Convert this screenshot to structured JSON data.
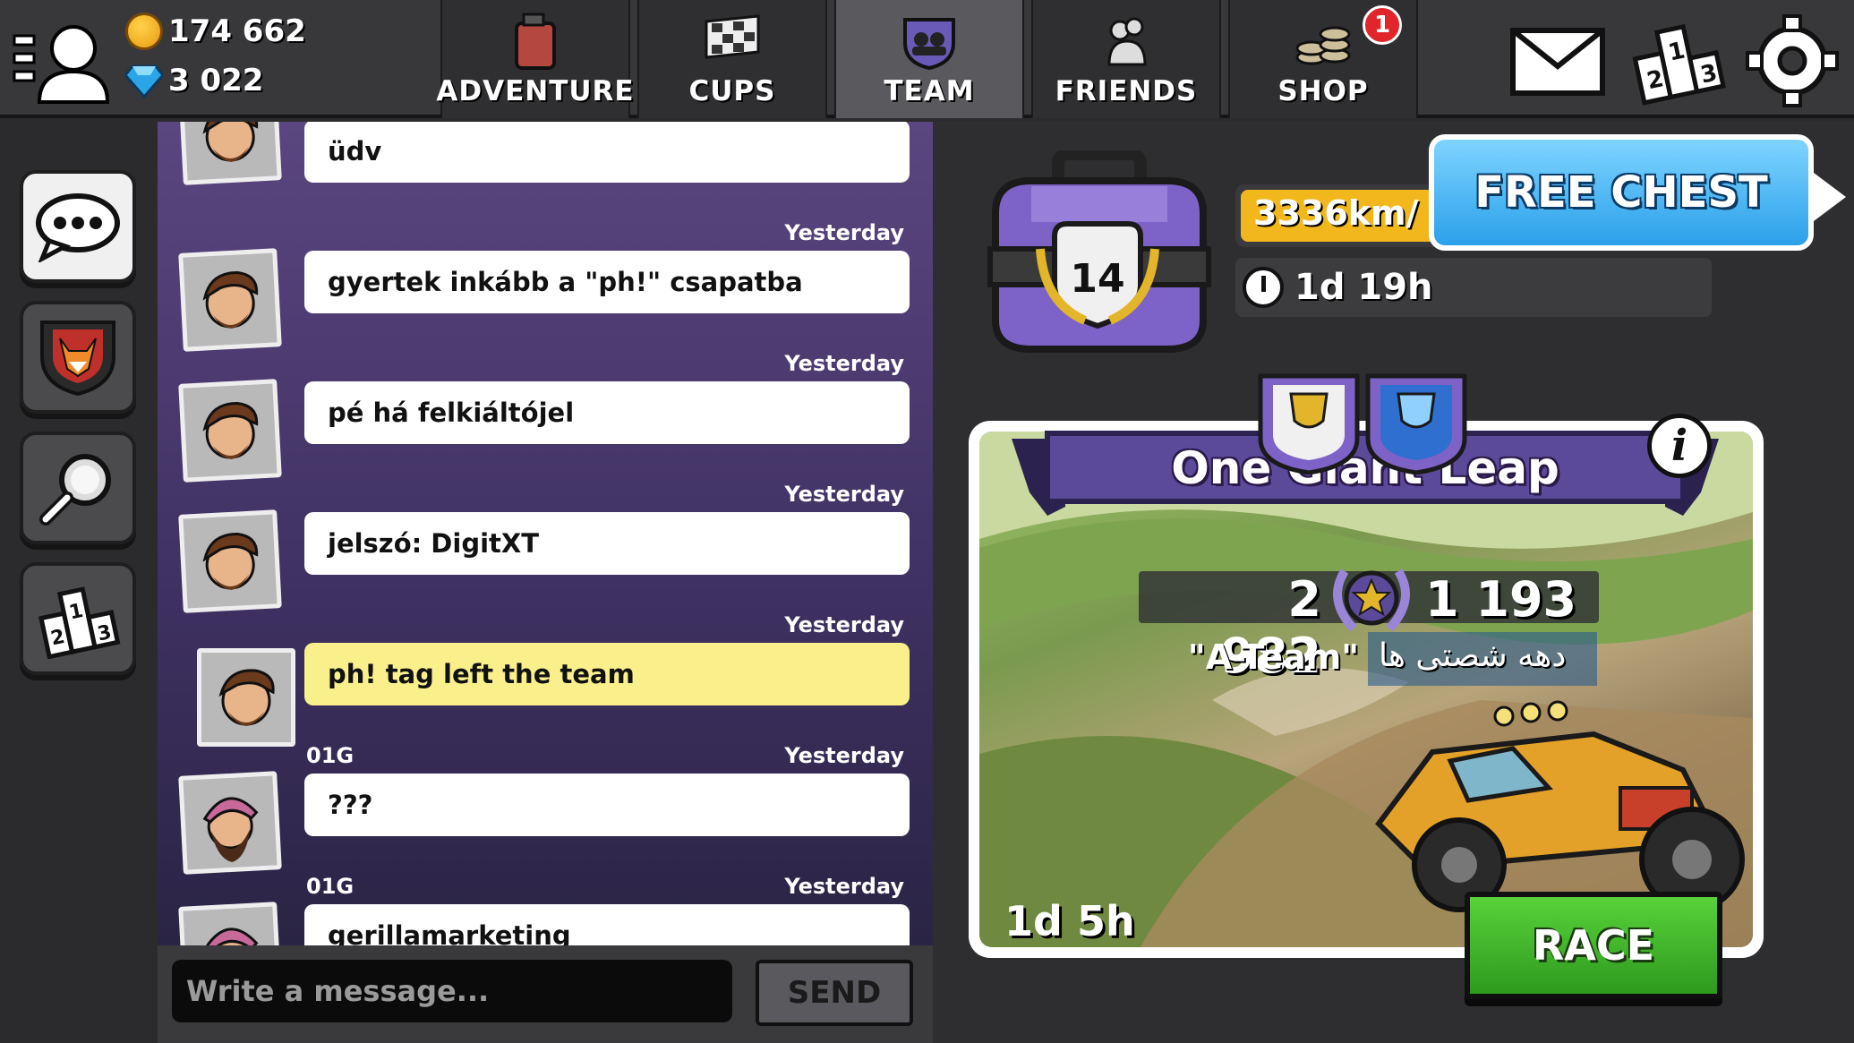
{
  "currency": {
    "coins": "174 662",
    "gems": "3 022"
  },
  "tabs": [
    {
      "label": "ADVENTURE",
      "icon": "fuel-can-icon"
    },
    {
      "label": "CUPS",
      "icon": "checkered-flag-icon"
    },
    {
      "label": "TEAM",
      "icon": "team-shield-icon",
      "active": true
    },
    {
      "label": "FRIENDS",
      "icon": "friends-icon"
    },
    {
      "label": "SHOP",
      "icon": "coin-stack-icon",
      "badge": "1"
    }
  ],
  "chat": {
    "messages": [
      {
        "author": "",
        "time": "",
        "text": "üdv",
        "system": false,
        "avatar": "brown-hair-driver-avatar"
      },
      {
        "author": "",
        "time": "Yesterday",
        "text": "gyertek inkább a \"ph!\" csapatba",
        "system": false,
        "avatar": "brown-hair-driver-avatar"
      },
      {
        "author": "",
        "time": "Yesterday",
        "text": "pé há felkiáltójel",
        "system": false,
        "avatar": "brown-hair-driver-avatar"
      },
      {
        "author": "",
        "time": "Yesterday",
        "text": "jelszó: DigitXT",
        "system": false,
        "avatar": "brown-hair-driver-avatar"
      },
      {
        "author": "",
        "time": "Yesterday",
        "text": "ph! tag left the team",
        "system": true,
        "avatar": "brown-hair-driver-avatar"
      },
      {
        "author": "01G",
        "time": "Yesterday",
        "text": "???",
        "system": false,
        "avatar": "bearded-beanie-avatar"
      },
      {
        "author": "01G",
        "time": "Yesterday",
        "text": "gerillamarketing",
        "system": false,
        "avatar": "bearded-beanie-avatar"
      }
    ],
    "input_placeholder": "Write a message...",
    "send_label": "SEND"
  },
  "chest": {
    "level": "14",
    "distance": "3336km/",
    "timer": "1d 19h",
    "free_chest_label": "FREE CHEST"
  },
  "event": {
    "title": "One Giant Leap",
    "score_left": "2 982",
    "score_right": "1 193",
    "team_left": "\"A-Team\"",
    "team_right": "دهه شصتی ها",
    "timer": "1d 5h",
    "race_label": "RACE"
  },
  "colors": {
    "chat_bg": "#5a4680",
    "system_bubble": "#f9f08c",
    "race_green": "#3fb82a",
    "free_chest_blue": "#2aa0ea",
    "banner_purple": "#5b4a9a",
    "badge_red": "#e1262b"
  }
}
